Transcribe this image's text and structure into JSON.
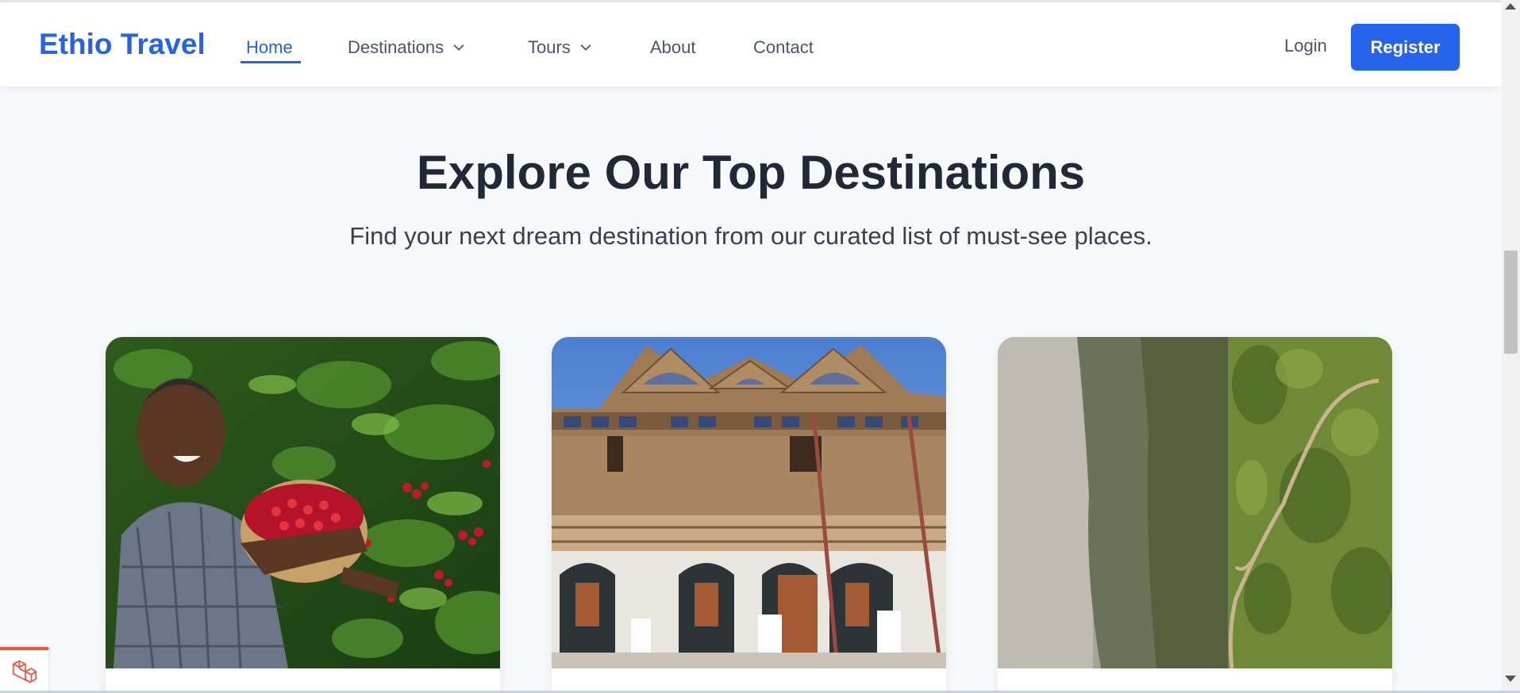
{
  "brand": "Ethio Travel",
  "nav": {
    "home": "Home",
    "destinations": "Destinations",
    "tours": "Tours",
    "about": "About",
    "contact": "Contact"
  },
  "auth": {
    "login": "Login",
    "register": "Register"
  },
  "section": {
    "title": "Explore Our Top Destinations",
    "subtitle": "Find your next dream destination from our curated list of must-see places."
  },
  "icons": {
    "nav_dropdown": "chevron-down-icon",
    "debug_badge": "laravel-logo-icon"
  },
  "colors": {
    "brand": "#2563eb",
    "text_dark": "#1f2937",
    "text_muted": "#4b5563",
    "background": "#f8f9fb"
  }
}
